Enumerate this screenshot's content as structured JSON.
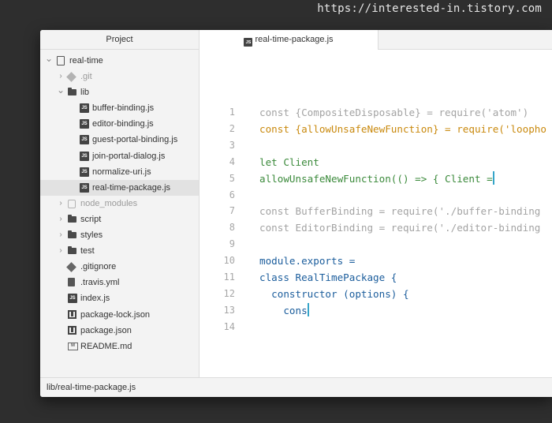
{
  "watermark": "https://interested-in.tistory.com",
  "sidebar": {
    "title": "Project",
    "items": [
      {
        "label": "real-time",
        "icon": "repo-icon",
        "chevron": "expanded"
      },
      {
        "label": ".git",
        "icon": "git-icon",
        "chevron": "collapsed",
        "dim": true
      },
      {
        "label": "lib",
        "icon": "folder-icon",
        "chevron": "expanded"
      },
      {
        "label": "buffer-binding.js",
        "icon": "js-file-icon"
      },
      {
        "label": "editor-binding.js",
        "icon": "js-file-icon"
      },
      {
        "label": "guest-portal-binding.js",
        "icon": "js-file-icon"
      },
      {
        "label": "join-portal-dialog.js",
        "icon": "js-file-icon"
      },
      {
        "label": "normalize-uri.js",
        "icon": "js-file-icon"
      },
      {
        "label": "real-time-package.js",
        "icon": "js-file-icon",
        "selected": true
      },
      {
        "label": "node_modules",
        "icon": "node-modules-icon",
        "chevron": "collapsed",
        "dim": true
      },
      {
        "label": "script",
        "icon": "folder-icon",
        "chevron": "collapsed"
      },
      {
        "label": "styles",
        "icon": "folder-icon",
        "chevron": "collapsed"
      },
      {
        "label": "test",
        "icon": "folder-icon",
        "chevron": "collapsed"
      },
      {
        "label": ".gitignore",
        "icon": "git-icon"
      },
      {
        "label": ".travis.yml",
        "icon": "file-icon"
      },
      {
        "label": "index.js",
        "icon": "js-file-icon"
      },
      {
        "label": "package-lock.json",
        "icon": "package-icon"
      },
      {
        "label": "package.json",
        "icon": "package-icon"
      },
      {
        "label": "README.md",
        "icon": "markdown-icon"
      }
    ]
  },
  "tab": {
    "label": "real-time-package.js",
    "icon": "js-file-icon"
  },
  "editor": {
    "lines": [
      {
        "n": "1",
        "parts": [
          {
            "t": "const {CompositeDisposable} = require('atom')",
            "c": "dim"
          }
        ]
      },
      {
        "n": "2",
        "parts": [
          {
            "t": "const {allowUnsafeNewFunction} = require('loopho",
            "c": "gold"
          }
        ]
      },
      {
        "n": "3",
        "parts": []
      },
      {
        "n": "4",
        "parts": [
          {
            "t": "let Client",
            "c": "green"
          }
        ]
      },
      {
        "n": "5",
        "parts": [
          {
            "t": "allowUnsafeNewFunction(() => { Client =",
            "c": "green"
          }
        ],
        "caret": true
      },
      {
        "n": "6",
        "parts": []
      },
      {
        "n": "7",
        "parts": [
          {
            "t": "const BufferBinding = require('./buffer-binding",
            "c": "dim"
          }
        ]
      },
      {
        "n": "8",
        "parts": [
          {
            "t": "const EditorBinding = require('./editor-binding",
            "c": "dim"
          }
        ]
      },
      {
        "n": "9",
        "parts": []
      },
      {
        "n": "10",
        "parts": [
          {
            "t": "module.exports =",
            "c": "blue"
          }
        ]
      },
      {
        "n": "11",
        "parts": [
          {
            "t": "class RealTimePackage {",
            "c": "blue"
          }
        ]
      },
      {
        "n": "12",
        "parts": [
          {
            "t": "  constructor (options) {",
            "c": "blue"
          }
        ]
      },
      {
        "n": "13",
        "parts": [
          {
            "t": "    cons",
            "c": "blue"
          }
        ],
        "caret": true
      },
      {
        "n": "14",
        "parts": []
      }
    ]
  },
  "status": {
    "path": "lib/real-time-package.js"
  },
  "colors": {
    "caret": "#35a5c9",
    "gold": "#c9890d",
    "green": "#3b8a3b",
    "blue": "#1b5d9c"
  }
}
